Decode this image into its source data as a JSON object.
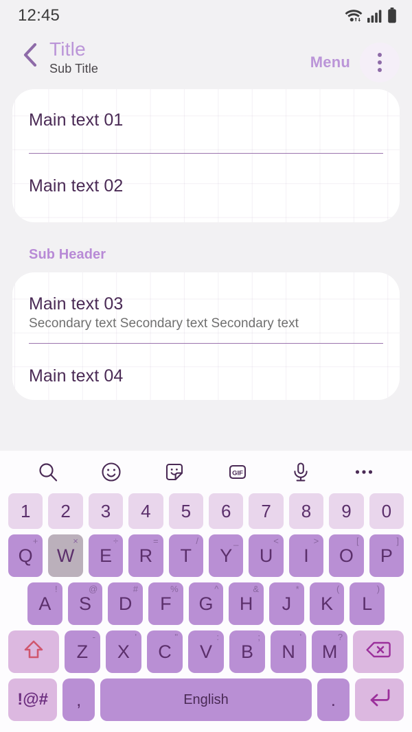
{
  "status_bar": {
    "time": "12:45",
    "icons": [
      "wifi-icon",
      "cellular-signal-icon",
      "battery-icon"
    ]
  },
  "app_bar": {
    "back_icon": "chevron-left-icon",
    "title": "Title",
    "subtitle": "Sub Title",
    "menu_label": "Menu",
    "overflow_icon": "more-vertical-icon"
  },
  "content": {
    "card1": {
      "rows": [
        {
          "title": "Main text 01"
        },
        {
          "title": "Main text 02"
        }
      ]
    },
    "sub_header": "Sub Header",
    "card2": {
      "rows": [
        {
          "title": "Main text 03",
          "secondary": "Secondary text Secondary text Secondary text"
        },
        {
          "title": "Main text 04"
        }
      ]
    }
  },
  "keyboard": {
    "toolbar": [
      {
        "name": "search-icon"
      },
      {
        "name": "emoji-icon"
      },
      {
        "name": "sticker-icon"
      },
      {
        "name": "gif-icon",
        "label": "GIF"
      },
      {
        "name": "microphone-icon"
      },
      {
        "name": "more-horizontal-icon"
      }
    ],
    "rows": {
      "numbers": [
        "1",
        "2",
        "3",
        "4",
        "5",
        "6",
        "7",
        "8",
        "9",
        "0"
      ],
      "top": [
        {
          "key": "Q",
          "sup": "+"
        },
        {
          "key": "W",
          "sup": "×",
          "pressed": true
        },
        {
          "key": "E",
          "sup": "÷"
        },
        {
          "key": "R",
          "sup": "="
        },
        {
          "key": "T",
          "sup": "/"
        },
        {
          "key": "Y",
          "sup": "_"
        },
        {
          "key": "U",
          "sup": "<"
        },
        {
          "key": "I",
          "sup": ">"
        },
        {
          "key": "O",
          "sup": "["
        },
        {
          "key": "P",
          "sup": "]"
        }
      ],
      "home": [
        {
          "key": "A",
          "sup": "!"
        },
        {
          "key": "S",
          "sup": "@"
        },
        {
          "key": "D",
          "sup": "#"
        },
        {
          "key": "F",
          "sup": "%"
        },
        {
          "key": "G",
          "sup": "^"
        },
        {
          "key": "H",
          "sup": "&"
        },
        {
          "key": "J",
          "sup": "*"
        },
        {
          "key": "K",
          "sup": "("
        },
        {
          "key": "L",
          "sup": ")"
        }
      ],
      "bottom": [
        {
          "key": "Z",
          "sup": "-"
        },
        {
          "key": "X",
          "sup": "'"
        },
        {
          "key": "C",
          "sup": "\""
        },
        {
          "key": "V",
          "sup": ":"
        },
        {
          "key": "B",
          "sup": ";"
        },
        {
          "key": "N",
          "sup": "'"
        },
        {
          "key": "M",
          "sup": "?"
        }
      ]
    },
    "shift_icon": "shift-arrow-icon",
    "backspace_icon": "backspace-icon",
    "symbols_label": "!@#",
    "comma_label": ",",
    "space_label": "English",
    "period_label": ".",
    "enter_icon": "enter-arrow-icon"
  },
  "colors": {
    "page_bg": "#f2f1f3",
    "accent_purple": "#bb95d8",
    "key_letter": "#b98fd4",
    "key_number": "#e9d6ec",
    "key_special": "#dcb8e0",
    "key_pressed": "#bbb0bb",
    "text_dark": "#4a2a55",
    "shift_outline": "#d0566e"
  }
}
